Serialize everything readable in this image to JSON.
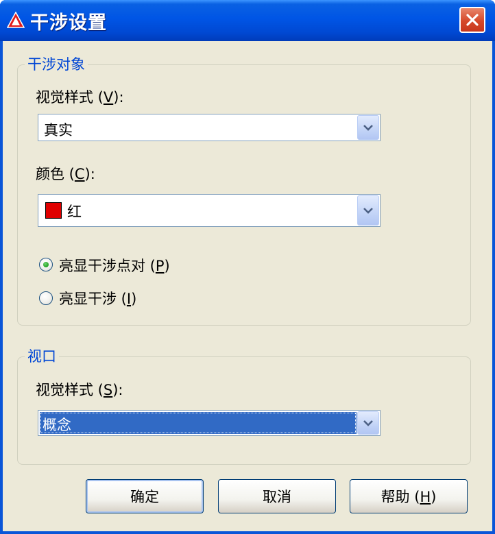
{
  "window": {
    "title": "干涉设置"
  },
  "interference_objects": {
    "legend": "干涉对象",
    "visual_style": {
      "label": "视觉样式",
      "mnemonic": "V",
      "value": "真实"
    },
    "color": {
      "label": "颜色",
      "mnemonic": "C",
      "value": "红",
      "swatch_color": "#e00000"
    },
    "radio_options": [
      {
        "label": "亮显干涉点对",
        "mnemonic": "P",
        "selected": true
      },
      {
        "label": "亮显干涉",
        "mnemonic": "I",
        "selected": false
      }
    ]
  },
  "viewport": {
    "legend": "视口",
    "visual_style": {
      "label": "视觉样式",
      "mnemonic": "S",
      "value": "概念"
    }
  },
  "buttons": {
    "ok": "确定",
    "cancel": "取消",
    "help": "帮助",
    "help_mnemonic": "H"
  },
  "colors": {
    "titlebar": "#0055e5",
    "dialog_bg": "#ece9d8",
    "legend_text": "#0046d5",
    "selection": "#316ac5"
  }
}
